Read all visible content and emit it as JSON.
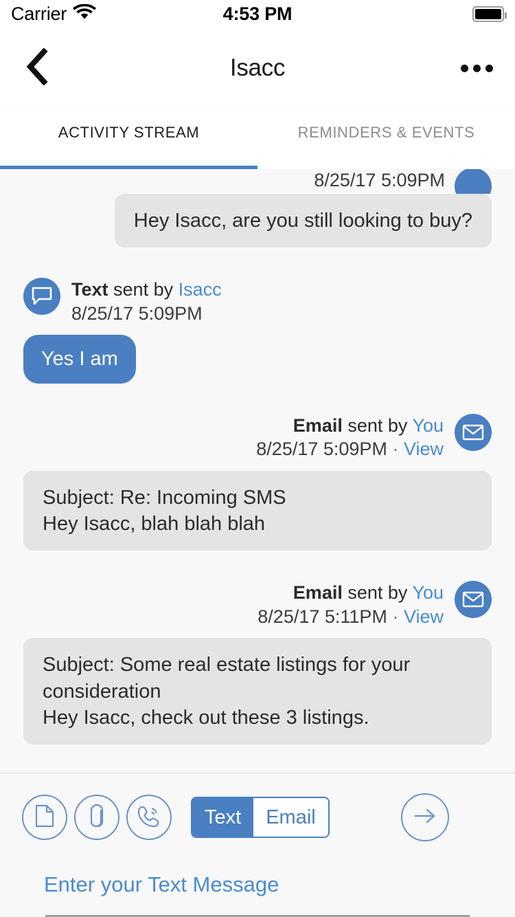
{
  "status_bar": {
    "carrier": "Carrier",
    "wifi_icon": "wifi-icon",
    "time": "4:53 PM",
    "battery_icon": "battery-full-icon"
  },
  "nav": {
    "back_icon": "chevron-left-icon",
    "title": "Isacc",
    "more_icon": "more-horizontal-icon"
  },
  "tabs": [
    {
      "label": "ACTIVITY STREAM",
      "active": true
    },
    {
      "label": "REMINDERS & EVENTS",
      "active": false
    }
  ],
  "stream": {
    "clipped_message": {
      "timestamp": "8/25/17 5:09PM",
      "avatar_icon": "chat-bubble-icon",
      "body": "Hey Isacc, are you still looking to buy?"
    },
    "messages": [
      {
        "kind": "Text",
        "sent_by_label": "sent by",
        "sender": "Isacc",
        "timestamp": "8/25/17 5:09PM",
        "avatar_icon": "chat-bubble-icon",
        "body": "Yes I am",
        "align": "left",
        "bubble": "blue"
      },
      {
        "kind": "Email",
        "sent_by_label": "sent by",
        "sender": "You",
        "timestamp": "8/25/17 5:09PM",
        "separator": "·",
        "view_label": "View",
        "avatar_icon": "envelope-icon",
        "subject_line": "Subject: Re: Incoming SMS",
        "body_line": "Hey Isacc, blah blah blah",
        "align": "right",
        "bubble": "gray"
      },
      {
        "kind": "Email",
        "sent_by_label": "sent by",
        "sender": "You",
        "timestamp": "8/25/17 5:11PM",
        "separator": "·",
        "view_label": "View",
        "avatar_icon": "envelope-icon",
        "subject_line": "Subject: Some real estate listings for your consideration",
        "body_line": "Hey  Isacc, check out these 3 listings.",
        "align": "right",
        "bubble": "gray"
      }
    ]
  },
  "composer": {
    "tools": [
      {
        "name": "document-icon",
        "label": "Document"
      },
      {
        "name": "paperclip-icon",
        "label": "Attachment"
      },
      {
        "name": "phone-call-icon",
        "label": "Call"
      }
    ],
    "mode_toggle": {
      "text_label": "Text",
      "email_label": "Email",
      "selected": "Text"
    },
    "send_icon": "arrow-right-icon",
    "input_placeholder": "Enter your Text Message",
    "input_value": ""
  },
  "colors": {
    "accent_blue": "#4a7fc1",
    "link_blue": "#4a8bd0",
    "bubble_gray": "#e4e4e4",
    "page_bg": "#f8f8f8"
  }
}
